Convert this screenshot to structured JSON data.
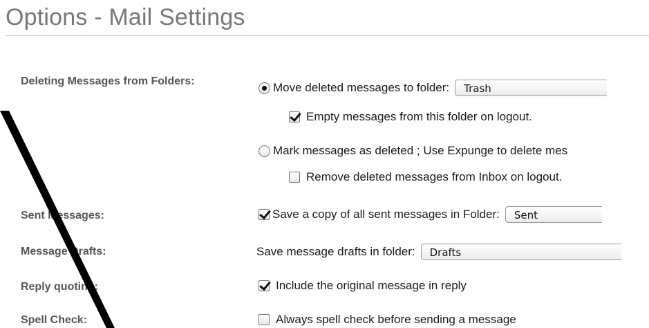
{
  "page": {
    "title": "Options - Mail Settings"
  },
  "deleting": {
    "label": "Deleting Messages from Folders:",
    "move_option": "Move deleted messages to folder:",
    "move_selected": true,
    "move_folder": "Trash",
    "empty_on_logout": "Empty messages from this folder on logout.",
    "empty_checked": true,
    "mark_option": "Mark messages as deleted ; Use Expunge to delete mes",
    "mark_selected": false,
    "remove_on_logout": "Remove deleted messages from Inbox on logout.",
    "remove_checked": false
  },
  "sent": {
    "label": "Sent Messages:",
    "save_copy": "Save a copy of all sent messages in Folder:",
    "save_checked": true,
    "folder": "Sent"
  },
  "drafts": {
    "label": "Message Drafts:",
    "save_text": "Save message drafts in folder:",
    "folder": "Drafts"
  },
  "reply": {
    "label": "Reply quoting:",
    "include_original": "Include the original message in reply",
    "include_checked": true
  },
  "spell": {
    "label": "Spell Check:",
    "always_spell": "Always spell check before sending a message",
    "always_checked": false
  },
  "colors": {
    "title": "#777777",
    "label": "#555555",
    "text": "#1a1a1a",
    "overlay_line": "#000000"
  }
}
